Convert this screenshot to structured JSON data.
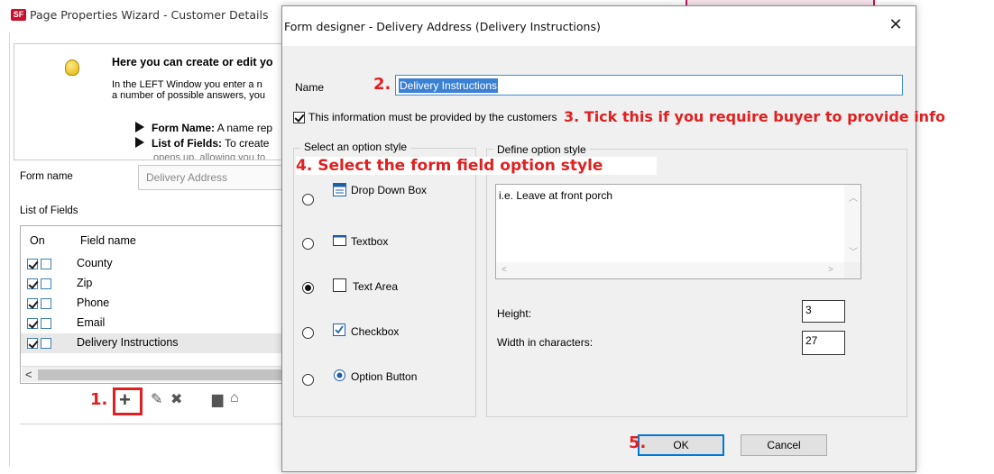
{
  "wizard": {
    "logo": "SF",
    "title": "Page Properties Wizard - Customer Details",
    "info_title": "Here you can create or edit yo",
    "info_line1": "In the LEFT Window you enter a n",
    "info_line2": "a number of possible answers, you",
    "bullet1_bold": "Form Name:",
    "bullet1_text": " A name rep",
    "bullet2_bold": "List of Fields:",
    "bullet2_text": " To create",
    "bullet3_text": "opens up, allowing you to",
    "form_name_label": "Form name",
    "form_name_value": "Delivery Address",
    "list_label": "List of Fields",
    "list_headers": {
      "on": "On",
      "field_name": "Field name"
    },
    "rows": [
      {
        "label": "County",
        "checked": true
      },
      {
        "label": "Zip",
        "checked": true
      },
      {
        "label": "Phone",
        "checked": true
      },
      {
        "label": "Email",
        "checked": true
      },
      {
        "label": "Delivery Instructions",
        "checked": true,
        "selected": true
      }
    ],
    "scroll_left": "<",
    "toolbar": {
      "add": "+",
      "edit": "✎",
      "delete": "✖",
      "camera": "▆",
      "info": "⌂"
    }
  },
  "dialog": {
    "title": "Form designer - Delivery Address (Delivery Instructions)",
    "close": "✕",
    "name_label": "Name",
    "name_value": "Delivery Instructions",
    "required_label": "This information must be provided by the customers",
    "required_checked": true,
    "option_group_label": "Select an option style",
    "define_group_label": "Define option style",
    "options": [
      {
        "label": "Drop Down Box",
        "icon": "dropdown-icon",
        "selected": false
      },
      {
        "label": "Textbox",
        "icon": "textbox-icon",
        "selected": false
      },
      {
        "label": "Text Area",
        "icon": "textarea-icon",
        "selected": true
      },
      {
        "label": "Checkbox",
        "icon": "checkbox-icon",
        "selected": false
      },
      {
        "label": "Option Button",
        "icon": "radio-icon",
        "selected": false
      }
    ],
    "textarea_value": "i.e. Leave at front porch",
    "height_label": "Height:",
    "height_value": "3",
    "width_label": "Width in characters:",
    "width_value": "27",
    "ok": "OK",
    "cancel": "Cancel"
  },
  "annotations": {
    "a1": "1.",
    "a2": "2.",
    "a3": "3. Tick this if you require buyer to provide info",
    "a4": "4. Select the form field option style",
    "a5": "5."
  },
  "colors": {
    "annotation": "#e02020",
    "selection": "#3a80d3",
    "focus_border": "#0078d7",
    "checkbox_border": "#3c7fb1"
  }
}
